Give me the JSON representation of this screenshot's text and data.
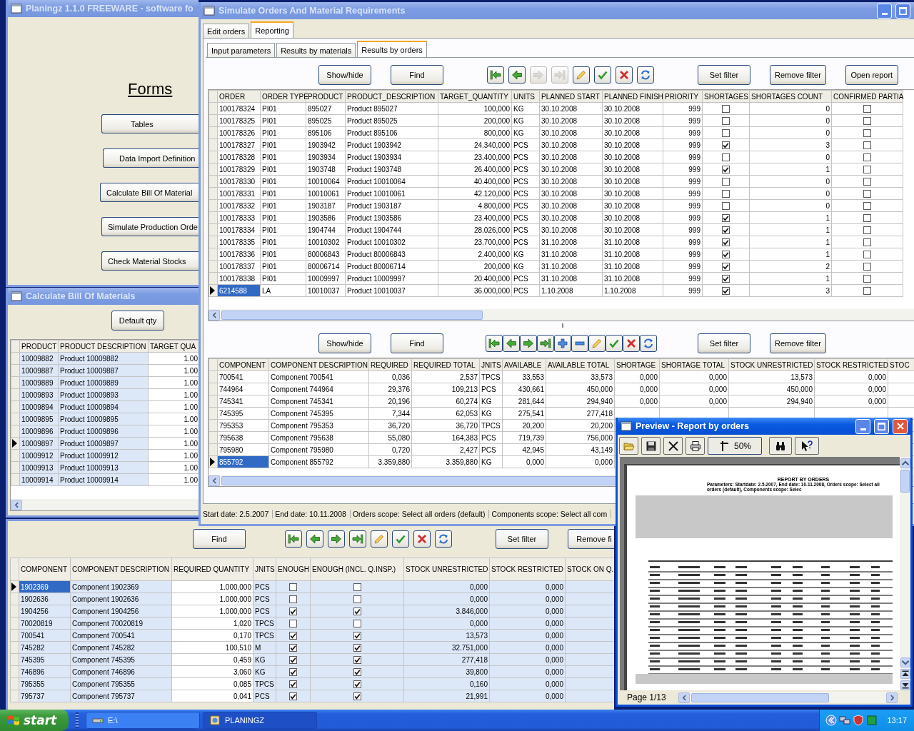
{
  "main_window": {
    "title": "Planingz 1.1.0 FREEWARE - software fo",
    "heading": "Forms",
    "buttons": [
      "Tables",
      "Data Import Definition",
      "Calculate Bill Of Material",
      "Simulate Production Orde",
      "Check Material Stocks"
    ]
  },
  "bom_window": {
    "title": "Calculate Bill Of Materials",
    "buttons": [
      "Default qty"
    ],
    "grid": {
      "columns": [
        {
          "label": "PRODUCT",
          "kind": "text",
          "shaded": true
        },
        {
          "label": "PRODUCT DESCRIPTION",
          "kind": "text",
          "shaded": true
        },
        {
          "label": "TARGET QUA",
          "kind": "number",
          "shaded": false
        }
      ],
      "rows": [
        {
          "cells": [
            "10009882",
            "Product 10009882",
            "1.00"
          ],
          "current": false,
          "selected": false
        },
        {
          "cells": [
            "10009887",
            "Product 10009887",
            "1.00"
          ],
          "current": false,
          "selected": false
        },
        {
          "cells": [
            "10009889",
            "Product 10009889",
            "1.00"
          ],
          "current": false,
          "selected": false
        },
        {
          "cells": [
            "10009893",
            "Product 10009893",
            "1.00"
          ],
          "current": false,
          "selected": false
        },
        {
          "cells": [
            "10009894",
            "Product 10009894",
            "1.00"
          ],
          "current": false,
          "selected": false
        },
        {
          "cells": [
            "10009895",
            "Product 10009895",
            "1.00"
          ],
          "current": false,
          "selected": false
        },
        {
          "cells": [
            "10009896",
            "Product 10009896",
            "1.00"
          ],
          "current": false,
          "selected": false
        },
        {
          "cells": [
            "10009897",
            "Product 10009897",
            "1.00"
          ],
          "current": true,
          "selected": false
        },
        {
          "cells": [
            "10009912",
            "Product 10009912",
            "1.00"
          ],
          "current": false,
          "selected": false
        },
        {
          "cells": [
            "10009913",
            "Product 10009913",
            "1.00"
          ],
          "current": false,
          "selected": false
        },
        {
          "cells": [
            "10009914",
            "Product 10009914",
            "1.00"
          ],
          "current": false,
          "selected": false
        }
      ]
    }
  },
  "stock_window": {
    "toolbar": [
      {
        "kind": "button",
        "label": "Find"
      },
      {
        "kind": "first",
        "disabled": false
      },
      {
        "kind": "prior",
        "disabled": false
      },
      {
        "kind": "next",
        "disabled": false
      },
      {
        "kind": "last",
        "disabled": false
      },
      {
        "kind": "edit",
        "disabled": false
      },
      {
        "kind": "post",
        "disabled": false
      },
      {
        "kind": "cancel",
        "disabled": false
      },
      {
        "kind": "refresh",
        "disabled": false
      },
      {
        "kind": "button",
        "label": "Set filter"
      },
      {
        "kind": "button",
        "label": "Remove fi"
      }
    ],
    "grid": {
      "columns": [
        {
          "label": "COMPONENT",
          "kind": "text",
          "shaded": true
        },
        {
          "label": "COMPONENT DESCRIPTION",
          "kind": "text",
          "shaded": true
        },
        {
          "label": "REQUIRED QUANTITY",
          "kind": "number",
          "shaded": false
        },
        {
          "label": "JNITS",
          "kind": "text",
          "shaded": true
        },
        {
          "label": "ENOUGH",
          "kind": "check",
          "shaded": true
        },
        {
          "label": "ENOUGH (INCL. Q.INSP.)",
          "kind": "check",
          "shaded": true
        },
        {
          "label": "STOCK UNRESTRICTED",
          "kind": "number",
          "shaded": true
        },
        {
          "label": "STOCK RESTRICTED",
          "kind": "number",
          "shaded": true
        },
        {
          "label": "STOCK ON Q.",
          "kind": "number",
          "shaded": true
        }
      ],
      "rows": [
        {
          "cells": [
            "1902369",
            "Component 1902369",
            "1.000,000",
            "PCS",
            false,
            false,
            "0,000",
            "0,000",
            null
          ],
          "current": true,
          "selected": true
        },
        {
          "cells": [
            "1902636",
            "Component 1902636",
            "1.000,000",
            "PCS",
            false,
            false,
            "0,000",
            "0,000",
            null
          ],
          "current": false,
          "selected": false
        },
        {
          "cells": [
            "1904256",
            "Component 1904256",
            "1.000,000",
            "PCS",
            true,
            true,
            "3.846,000",
            "0,000",
            null
          ],
          "current": false,
          "selected": false
        },
        {
          "cells": [
            "70020819",
            "Component 70020819",
            "1,020",
            "TPCS",
            false,
            false,
            "0,000",
            "0,000",
            null
          ],
          "current": false,
          "selected": false
        },
        {
          "cells": [
            "700541",
            "Component 700541",
            "0,170",
            "TPCS",
            true,
            true,
            "13,573",
            "0,000",
            null
          ],
          "current": false,
          "selected": false
        },
        {
          "cells": [
            "745282",
            "Component 745282",
            "100,510",
            "M",
            true,
            true,
            "32.751,000",
            "0,000",
            null
          ],
          "current": false,
          "selected": false
        },
        {
          "cells": [
            "745395",
            "Component 745395",
            "0,459",
            "KG",
            true,
            true,
            "277,418",
            "0,000",
            null
          ],
          "current": false,
          "selected": false
        },
        {
          "cells": [
            "746896",
            "Component 746896",
            "3,060",
            "KG",
            true,
            true,
            "39,800",
            "0,000",
            null
          ],
          "current": false,
          "selected": false
        },
        {
          "cells": [
            "795355",
            "Component 795355",
            "0,085",
            "TPCS",
            true,
            true,
            "0,160",
            "0,000",
            null
          ],
          "current": false,
          "selected": false
        },
        {
          "cells": [
            "795737",
            "Component 795737",
            "0,041",
            "PCS",
            true,
            true,
            "21,991",
            "0,000",
            null
          ],
          "current": false,
          "selected": false
        }
      ]
    }
  },
  "simulate_window": {
    "title": "Simulate Orders And Material Requirements",
    "tabs": [
      {
        "label": "Edit orders",
        "selected": false
      },
      {
        "label": "Reporting",
        "selected": true
      }
    ],
    "subtabs": [
      {
        "label": "Input parameters",
        "selected": false
      },
      {
        "label": "Results by materials",
        "selected": false
      },
      {
        "label": "Results by orders",
        "selected": true
      }
    ],
    "top_toolbar": [
      {
        "kind": "button",
        "label": "Show/hide"
      },
      {
        "kind": "button",
        "label": "Find"
      },
      {
        "kind": "first",
        "disabled": false
      },
      {
        "kind": "prior",
        "disabled": false
      },
      {
        "kind": "next",
        "disabled": true
      },
      {
        "kind": "last",
        "disabled": true
      },
      {
        "kind": "edit",
        "disabled": false
      },
      {
        "kind": "post",
        "disabled": false
      },
      {
        "kind": "cancel",
        "disabled": false
      },
      {
        "kind": "refresh",
        "disabled": false
      },
      {
        "kind": "button",
        "label": "Set filter"
      },
      {
        "kind": "button",
        "label": "Remove filter"
      },
      {
        "kind": "button",
        "label": "Open report"
      }
    ],
    "top_grid": {
      "columns": [
        {
          "label": "ORDER",
          "kind": "text"
        },
        {
          "label": "ORDER TYPE",
          "kind": "text"
        },
        {
          "label": "PRODUCT",
          "kind": "text"
        },
        {
          "label": "PRODUCT_DESCRIPTION",
          "kind": "text"
        },
        {
          "label": "TARGET_QUANTITY",
          "kind": "number"
        },
        {
          "label": "UNITS",
          "kind": "text"
        },
        {
          "label": "PLANNED START",
          "kind": "text"
        },
        {
          "label": "PLANNED FINISH",
          "kind": "text"
        },
        {
          "label": "PRIORITY",
          "kind": "number"
        },
        {
          "label": "SHORTAGES",
          "kind": "check"
        },
        {
          "label": "SHORTAGES COUNT",
          "kind": "number"
        },
        {
          "label": "CONFIRMED PARTIA",
          "kind": "check"
        }
      ],
      "rows": [
        {
          "cells": [
            "100178324",
            "PI01",
            "895027",
            "Product 895027",
            "100,000",
            "KG",
            "30.10.2008",
            "30.10.2008",
            "999",
            false,
            "0",
            false
          ],
          "current": false,
          "selected": false
        },
        {
          "cells": [
            "100178325",
            "PI01",
            "895025",
            "Product 895025",
            "200,000",
            "KG",
            "30.10.2008",
            "30.10.2008",
            "999",
            false,
            "0",
            false
          ],
          "current": false,
          "selected": false
        },
        {
          "cells": [
            "100178326",
            "PI01",
            "895106",
            "Product 895106",
            "800,000",
            "KG",
            "30.10.2008",
            "30.10.2008",
            "999",
            false,
            "0",
            false
          ],
          "current": false,
          "selected": false
        },
        {
          "cells": [
            "100178327",
            "PI01",
            "1903942",
            "Product 1903942",
            "24.340,000",
            "PCS",
            "30.10.2008",
            "30.10.2008",
            "999",
            true,
            "3",
            false
          ],
          "current": false,
          "selected": false
        },
        {
          "cells": [
            "100178328",
            "PI01",
            "1903934",
            "Product 1903934",
            "23.400,000",
            "PCS",
            "30.10.2008",
            "30.10.2008",
            "999",
            false,
            "0",
            false
          ],
          "current": false,
          "selected": false
        },
        {
          "cells": [
            "100178329",
            "PI01",
            "1903748",
            "Product 1903748",
            "26.400,000",
            "PCS",
            "30.10.2008",
            "30.10.2008",
            "999",
            true,
            "1",
            false
          ],
          "current": false,
          "selected": false
        },
        {
          "cells": [
            "100178330",
            "PI01",
            "10010064",
            "Product 10010064",
            "40.400,000",
            "PCS",
            "30.10.2008",
            "30.10.2008",
            "999",
            false,
            "0",
            false
          ],
          "current": false,
          "selected": false
        },
        {
          "cells": [
            "100178331",
            "PI01",
            "10010061",
            "Product 10010061",
            "42.120,000",
            "PCS",
            "30.10.2008",
            "30.10.2008",
            "999",
            false,
            "0",
            false
          ],
          "current": false,
          "selected": false
        },
        {
          "cells": [
            "100178332",
            "PI01",
            "1903187",
            "Product 1903187",
            "4.800,000",
            "PCS",
            "30.10.2008",
            "30.10.2008",
            "999",
            false,
            "0",
            false
          ],
          "current": false,
          "selected": false
        },
        {
          "cells": [
            "100178333",
            "PI01",
            "1903586",
            "Product 1903586",
            "23.400,000",
            "PCS",
            "30.10.2008",
            "30.10.2008",
            "999",
            true,
            "1",
            false
          ],
          "current": false,
          "selected": false
        },
        {
          "cells": [
            "100178334",
            "PI01",
            "1904744",
            "Product 1904744",
            "28.026,000",
            "PCS",
            "30.10.2008",
            "30.10.2008",
            "999",
            true,
            "1",
            false
          ],
          "current": false,
          "selected": false
        },
        {
          "cells": [
            "100178335",
            "PI01",
            "10010302",
            "Product 10010302",
            "23.700,000",
            "PCS",
            "31.10.2008",
            "31.10.2008",
            "999",
            true,
            "1",
            false
          ],
          "current": false,
          "selected": false
        },
        {
          "cells": [
            "100178336",
            "PI01",
            "80006843",
            "Product 80006843",
            "2.400,000",
            "KG",
            "31.10.2008",
            "31.10.2008",
            "999",
            true,
            "1",
            false
          ],
          "current": false,
          "selected": false
        },
        {
          "cells": [
            "100178337",
            "PI01",
            "80006714",
            "Product 80006714",
            "200,000",
            "KG",
            "31.10.2008",
            "31.10.2008",
            "999",
            true,
            "2",
            false
          ],
          "current": false,
          "selected": false
        },
        {
          "cells": [
            "100178338",
            "PI01",
            "10009997",
            "Product 10009997",
            "20.400,000",
            "PCS",
            "31.10.2008",
            "31.10.2008",
            "999",
            true,
            "1",
            false
          ],
          "current": false,
          "selected": false
        },
        {
          "cells": [
            "6214588",
            "LA",
            "10010037",
            "Product 10010037",
            "36.000,000",
            "PCS",
            "1.10.2008",
            "1.10.2008",
            "999",
            true,
            "3",
            false
          ],
          "current": true,
          "selected": true
        }
      ]
    },
    "bottom_toolbar": [
      {
        "kind": "button",
        "label": "Show/hide"
      },
      {
        "kind": "button",
        "label": "Find"
      },
      {
        "kind": "first",
        "disabled": false
      },
      {
        "kind": "prior",
        "disabled": false
      },
      {
        "kind": "next",
        "disabled": false
      },
      {
        "kind": "last",
        "disabled": false
      },
      {
        "kind": "insert",
        "disabled": false
      },
      {
        "kind": "delete",
        "disabled": false
      },
      {
        "kind": "edit",
        "disabled": false
      },
      {
        "kind": "post",
        "disabled": false
      },
      {
        "kind": "cancel",
        "disabled": false
      },
      {
        "kind": "refresh",
        "disabled": false
      },
      {
        "kind": "button",
        "label": "Set filter"
      },
      {
        "kind": "button",
        "label": "Remove filter"
      }
    ],
    "bottom_grid": {
      "columns": [
        {
          "label": "COMPONENT",
          "kind": "text"
        },
        {
          "label": "COMPONENT DESCRIPTION",
          "kind": "text"
        },
        {
          "label": "REQUIRED",
          "kind": "number"
        },
        {
          "label": "REQUIRED TOTAL",
          "kind": "number"
        },
        {
          "label": "JNITS",
          "kind": "text"
        },
        {
          "label": "AVAILABLE",
          "kind": "number"
        },
        {
          "label": "AVAILABLE TOTAL",
          "kind": "number"
        },
        {
          "label": "SHORTAGE",
          "kind": "number"
        },
        {
          "label": "SHORTAGE TOTAL",
          "kind": "number"
        },
        {
          "label": "STOCK UNRESTRICTED",
          "kind": "number"
        },
        {
          "label": "STOCK RESTRICTED",
          "kind": "number"
        },
        {
          "label": "STOC",
          "kind": "number"
        }
      ],
      "rows": [
        {
          "cells": [
            "700541",
            "Component 700541",
            "0,036",
            "2,537",
            "TPCS",
            "33,553",
            "33,573",
            "0,000",
            "0,000",
            "13,573",
            "0,000",
            null
          ],
          "current": false,
          "selected": false
        },
        {
          "cells": [
            "744964",
            "Component 744964",
            "29,376",
            "109,213",
            "PCS",
            "430,661",
            "450,000",
            "0,000",
            "0,000",
            "450,000",
            "0,000",
            null
          ],
          "current": false,
          "selected": false
        },
        {
          "cells": [
            "745341",
            "Component 745341",
            "20,196",
            "60,274",
            "KG",
            "281,644",
            "294,940",
            "0,000",
            "0,000",
            "294,940",
            "0,000",
            null
          ],
          "current": false,
          "selected": false
        },
        {
          "cells": [
            "745395",
            "Component 745395",
            "7,344",
            "62,053",
            "KG",
            "275,541",
            "277,418",
            null,
            null,
            null,
            null,
            null
          ],
          "current": false,
          "selected": false
        },
        {
          "cells": [
            "795353",
            "Component 795353",
            "36,720",
            "36,720",
            "TPCS",
            "20,200",
            "20,200",
            null,
            null,
            null,
            null,
            null
          ],
          "current": false,
          "selected": false
        },
        {
          "cells": [
            "795638",
            "Component 795638",
            "55,080",
            "164,383",
            "PCS",
            "719,739",
            "756,000",
            null,
            null,
            null,
            null,
            null
          ],
          "current": false,
          "selected": false
        },
        {
          "cells": [
            "795980",
            "Component 795980",
            "0,720",
            "2,427",
            "PCS",
            "42,945",
            "43,149",
            null,
            null,
            null,
            null,
            null
          ],
          "current": false,
          "selected": false
        },
        {
          "cells": [
            "855792",
            "Component 855792",
            "3.359,880",
            "3.359,880",
            "KG",
            "0,000",
            "0,000",
            null,
            null,
            null,
            null,
            null
          ],
          "current": true,
          "selected": true
        }
      ]
    },
    "status_bar": [
      "Start date: 2.5.2007",
      "End date: 10.11.2008",
      "Orders scope: Select all orders (default)",
      "Components scope: Select all com"
    ]
  },
  "preview_window": {
    "title": "Preview - Report by orders",
    "tools": [
      {
        "kind": "open"
      },
      {
        "kind": "save"
      },
      {
        "kind": "close"
      },
      {
        "kind": "print"
      },
      {
        "kind": "zoom",
        "label": "50%"
      },
      {
        "kind": "find"
      },
      {
        "kind": "help"
      }
    ],
    "report": {
      "title": "REPORT BY ORDERS",
      "parameters": "Parameters: Startdate: 2.5.2007, End date: 10.11.2008, Orders scope: Select all orders (default), Components scope: Selec"
    },
    "page_indicator": "Page 1/13"
  },
  "taskbar": {
    "start": "start",
    "tasks": [
      {
        "label": "E:\\",
        "selected": false
      },
      {
        "label": "PLANINGZ",
        "selected": true
      }
    ],
    "clock": "13:17"
  }
}
